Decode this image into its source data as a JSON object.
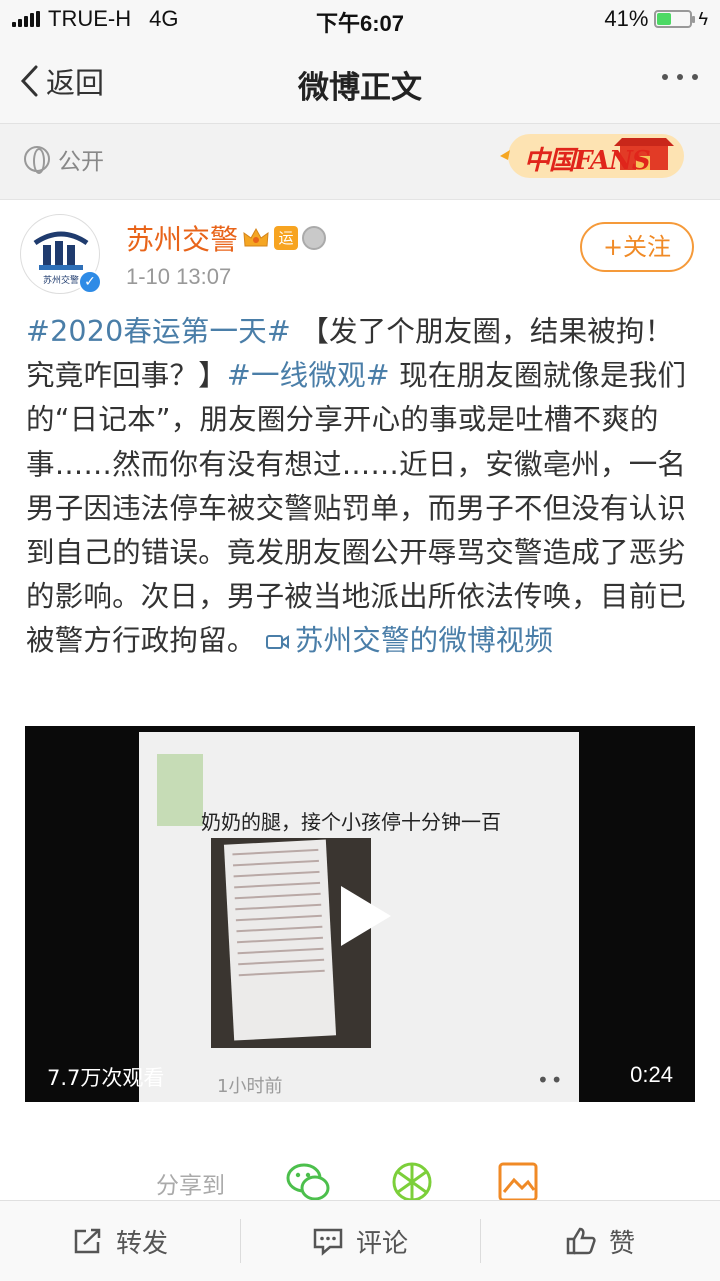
{
  "status_bar": {
    "carrier": "TRUE-H",
    "network": "4G",
    "time": "下午6:07",
    "battery": "41%",
    "battery_level": 0.41
  },
  "nav": {
    "back_label": "返回",
    "title": "微博正文",
    "more_icon": "more-dots-icon"
  },
  "visibility": {
    "label": "公开",
    "badge": "中国FANS"
  },
  "post": {
    "author": "苏州交警",
    "avatar_text": "苏州交警",
    "verified_icon": "v-verified-icon",
    "badges": [
      "crown-icon",
      "运",
      "medal-icon"
    ],
    "time": "1-10 13:07",
    "follow_label": "+关注",
    "topic1": "#2020春运第一天#",
    "title": "【发了个朋友圈，结果被拘！究竟咋回事？】",
    "topic2": "#一线微观#",
    "text": "现在朋友圈就像是我们的“日记本”，朋友圈分享开心的事或是吐槽不爽的事……然而你有没有想过……近日，安徽亳州，一名男子因违法停车被交警贴罚单，而男子不但没有认识到自己的错误。竟发朋友圈公开辱骂交警造成了恶劣的影响。次日，男子被当地派出所依法传唤，目前已被警方行政拘留。",
    "video_link": "苏州交警的微博视频"
  },
  "video": {
    "caption": "奶奶的腿，接个小孩停十分钟一百",
    "inner_time": "1小时前",
    "inner_dots": "••",
    "views": "7.7万次观看",
    "duration": "0:24"
  },
  "share": {
    "label": "分享到",
    "targets": [
      "wechat-icon",
      "moments-icon",
      "picture-icon"
    ]
  },
  "toolbar": {
    "repost": "转发",
    "comment": "评论",
    "like": "赞"
  },
  "colors": {
    "accent_orange": "#f08a26",
    "link_blue": "#4a7ea8",
    "author_orange": "#e8641a"
  }
}
